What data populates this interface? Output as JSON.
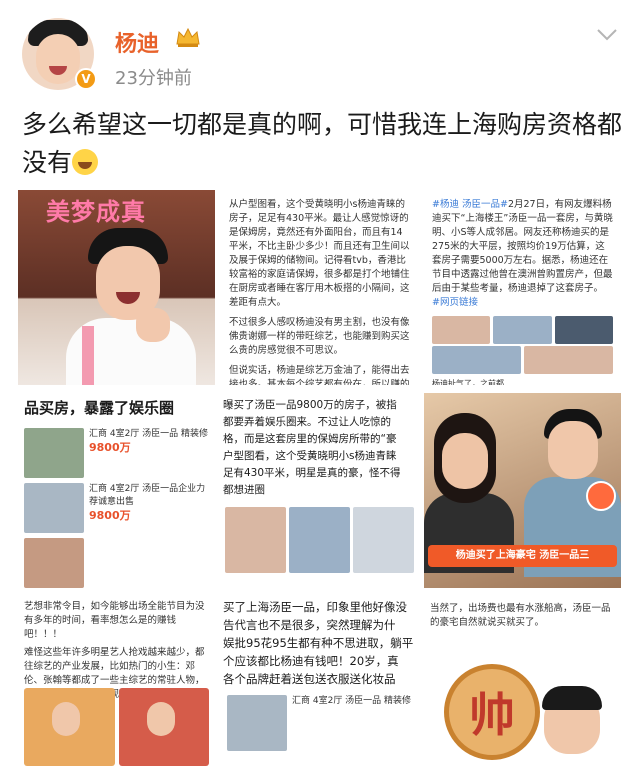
{
  "post": {
    "username": "杨迪",
    "timestamp": "23分钟前",
    "verified_badge": "V",
    "text": "多么希望这一切都是真的啊，可惜我连上海购房资格都没有",
    "emoji": "laughing-tears-emoji"
  },
  "images": {
    "cell1": {
      "sign": "美梦成真"
    },
    "cell2": {
      "para1": "从户型图看，这个受黄晓明小s杨迪青睐的房子，足足有430平米。最让人感觉惊讶的是保姆房，竟然还有外面阳台，而且有14平米，不比主卧少多少！而且还有卫生间以及展于保姆的储物间。记得看tvb，香港比较富裕的家庭请保姆，很多都是打个地铺住在厨房或者睡在客厅用木板搭的小隔间，这差距有点大。",
      "para2": "不过很多人感叹杨迪没有男主割，也没有像佛贵谢娜一样的带旺综艺，也能赚到购买这么贵的房感觉很不可思议。",
      "para3": "但说实话，杨迪是综艺万金油了，能得出去接也多。基本每个综艺都有份在，所以赚的不少的"
    },
    "cell3": {
      "tag": "#杨迪 汤臣一品#",
      "text": "2月27日，有网友爆料杨迪买下“上海楼王”汤臣一品一套房，与黄晓明、小S等人成邻居。网友还称杨迪买的是275米的大平层，按照均价19万估算，这套房子需要5000万左右。据悉，杨迪还在节目中透露过他曾在澳洲曾购置房产，但最后由于某些考量，杨迪退掉了这套房子。",
      "source": "#网页链接",
      "caption": "杨迪扯气了，之前都"
    },
    "cell4": {
      "headline": "品买房，暴露了娱乐圈",
      "listing1_title": "汇商 4室2厅 汤臣一品 精装修",
      "listing1_price": "9800万",
      "listing2_title": "汇商 4室2厅 汤臣一品企业力荐诚意出售",
      "listing2_price": "9800万"
    },
    "cell5": {
      "line1": "曝买了汤臣一品9800万的房子，被指",
      "line2": "都要弄着娱乐圈来。不过让人吃惊的",
      "line3": "格，而是这套房里的保姆房所带的“豪",
      "line4": "户型图看，这个受黄晓明小s杨迪青睐",
      "line5": "足有430平米，明星是真的豪，怪不得",
      "line6": "都想进圈"
    },
    "cell6": {
      "banner": "杨迪买了上海豪宅 汤臣一品三"
    },
    "cell7": {
      "text1": "艺想非常令目，如今能够出场全能节目为没有多年的时间，看率想怎么是的赚钱吧！！！",
      "text2": "难怪这些年许多明星艺人抢戏越来越少，都往综艺的产业发展，比如热门的小生：邓伦、张翰等都成了一些主综艺的常驻人物，而拥有自百巨额的影视在此前也是很赚钱各种综艺，甚少排戏。"
    },
    "cell8": {
      "line1": "买了上海汤臣一品，印象里他好像没",
      "line2": "告代言也不是很多，突然理解为什",
      "line3": "娱批95花95生都有种不思进取，躺平",
      "line4": "个应该都比杨迪有钱吧！20岁，真",
      "line5": "各个品牌赶着送包送衣服送化妆品",
      "listing_title": "汇商 4室2厅 汤臣一品 精装修"
    },
    "cell9": {
      "text": "当然了，出场费也最有水涨船高，汤臣一品的豪宅自然就说买就买了。",
      "chess": "帅"
    }
  },
  "colors": {
    "username": "#e8622b",
    "timestamp": "#8b8b8b",
    "badge": "#f39b15"
  }
}
